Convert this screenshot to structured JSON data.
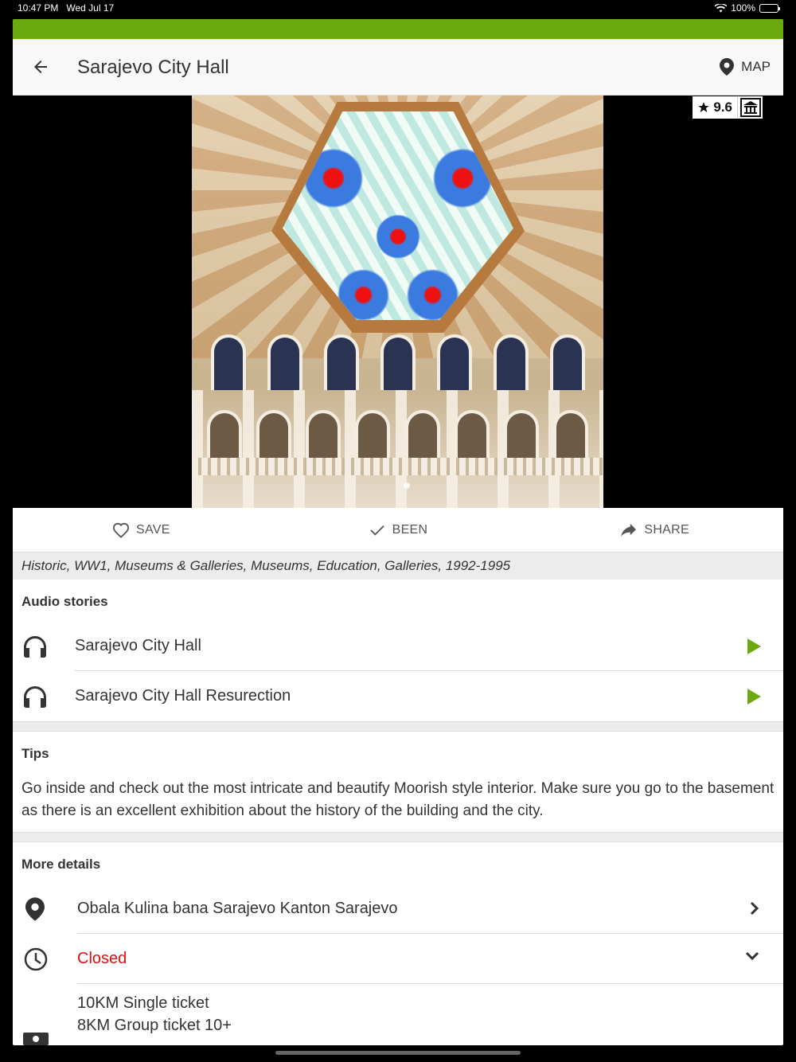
{
  "status_bar": {
    "time": "10:47 PM",
    "date": "Wed Jul 17",
    "battery": "100%"
  },
  "colors": {
    "accent": "#6aaa0f",
    "closed": "#e01010",
    "play": "#6aaa0f"
  },
  "header": {
    "title": "Sarajevo City Hall",
    "map_label": "MAP",
    "back_icon": "arrow-left-icon",
    "map_icon": "map-pin-icon"
  },
  "hero": {
    "rating": "9.6",
    "category_icon": "museum-icon",
    "photo": "interior-dome-photo"
  },
  "actions": [
    {
      "label": "SAVE",
      "icon": "heart-icon"
    },
    {
      "label": "BEEN",
      "icon": "check-icon"
    },
    {
      "label": "SHARE",
      "icon": "share-icon"
    }
  ],
  "categories": "Historic, WW1, Museums & Galleries, Museums, Education, Galleries, 1992-1995",
  "audio": {
    "title": "Audio stories",
    "items": [
      {
        "label": "Sarajevo City Hall"
      },
      {
        "label": "Sarajevo City Hall Resurection"
      }
    ]
  },
  "tips": {
    "title": "Tips",
    "text": "Go inside and check out the most intricate and beautify Moorish style interior. Make sure you go to the basement as there is an excellent exhibition about the history of the building and the city."
  },
  "details": {
    "title": "More details",
    "address": "Obala Kulina bana Sarajevo Kanton Sarajevo",
    "hours": "Closed",
    "prices": [
      "10KM Single ticket",
      "8KM Group ticket 10+"
    ]
  }
}
